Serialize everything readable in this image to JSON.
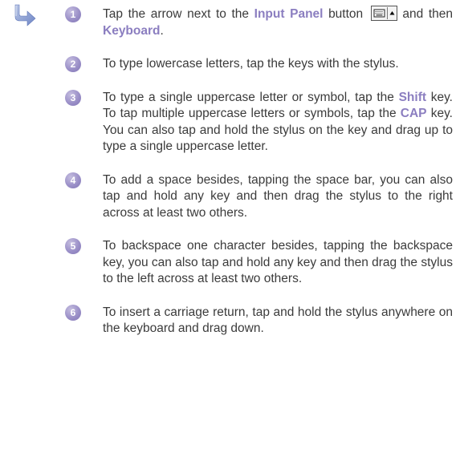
{
  "icons": {
    "arrow": "go-arrow-icon",
    "input_panel_button": "keyboard-icon"
  },
  "colors": {
    "accent": "#8b7ec0",
    "number_badge": "#9b90c8",
    "text": "#3b3b3b"
  },
  "steps": [
    {
      "number": "1",
      "t1": "Tap the arrow next to the ",
      "h1": "Input Panel",
      "t2": " button",
      "t3": " and then ",
      "h2": "Keyboard",
      "t4": "."
    },
    {
      "number": "2",
      "text": "To type lowercase letters, tap the keys with the stylus."
    },
    {
      "number": "3",
      "t1": "To type a single uppercase letter or symbol, tap the ",
      "h1": "Shift",
      "t2": " key. To tap multiple uppercase letters or symbols, tap the ",
      "h2": "CAP",
      "t3": " key.  You can also tap and hold the stylus on the key and drag up to type a single uppercase letter."
    },
    {
      "number": "4",
      "text": "To add a space besides, tapping the space bar, you can also tap and hold any key and then drag the stylus to the right across at least two others."
    },
    {
      "number": "5",
      "text": "To backspace one character besides, tapping the backspace key, you can also tap and hold any key and then drag the stylus to the left across at least two others."
    },
    {
      "number": "6",
      "text": "To insert a carriage return, tap and hold the stylus anywhere on the keyboard and drag down."
    }
  ]
}
